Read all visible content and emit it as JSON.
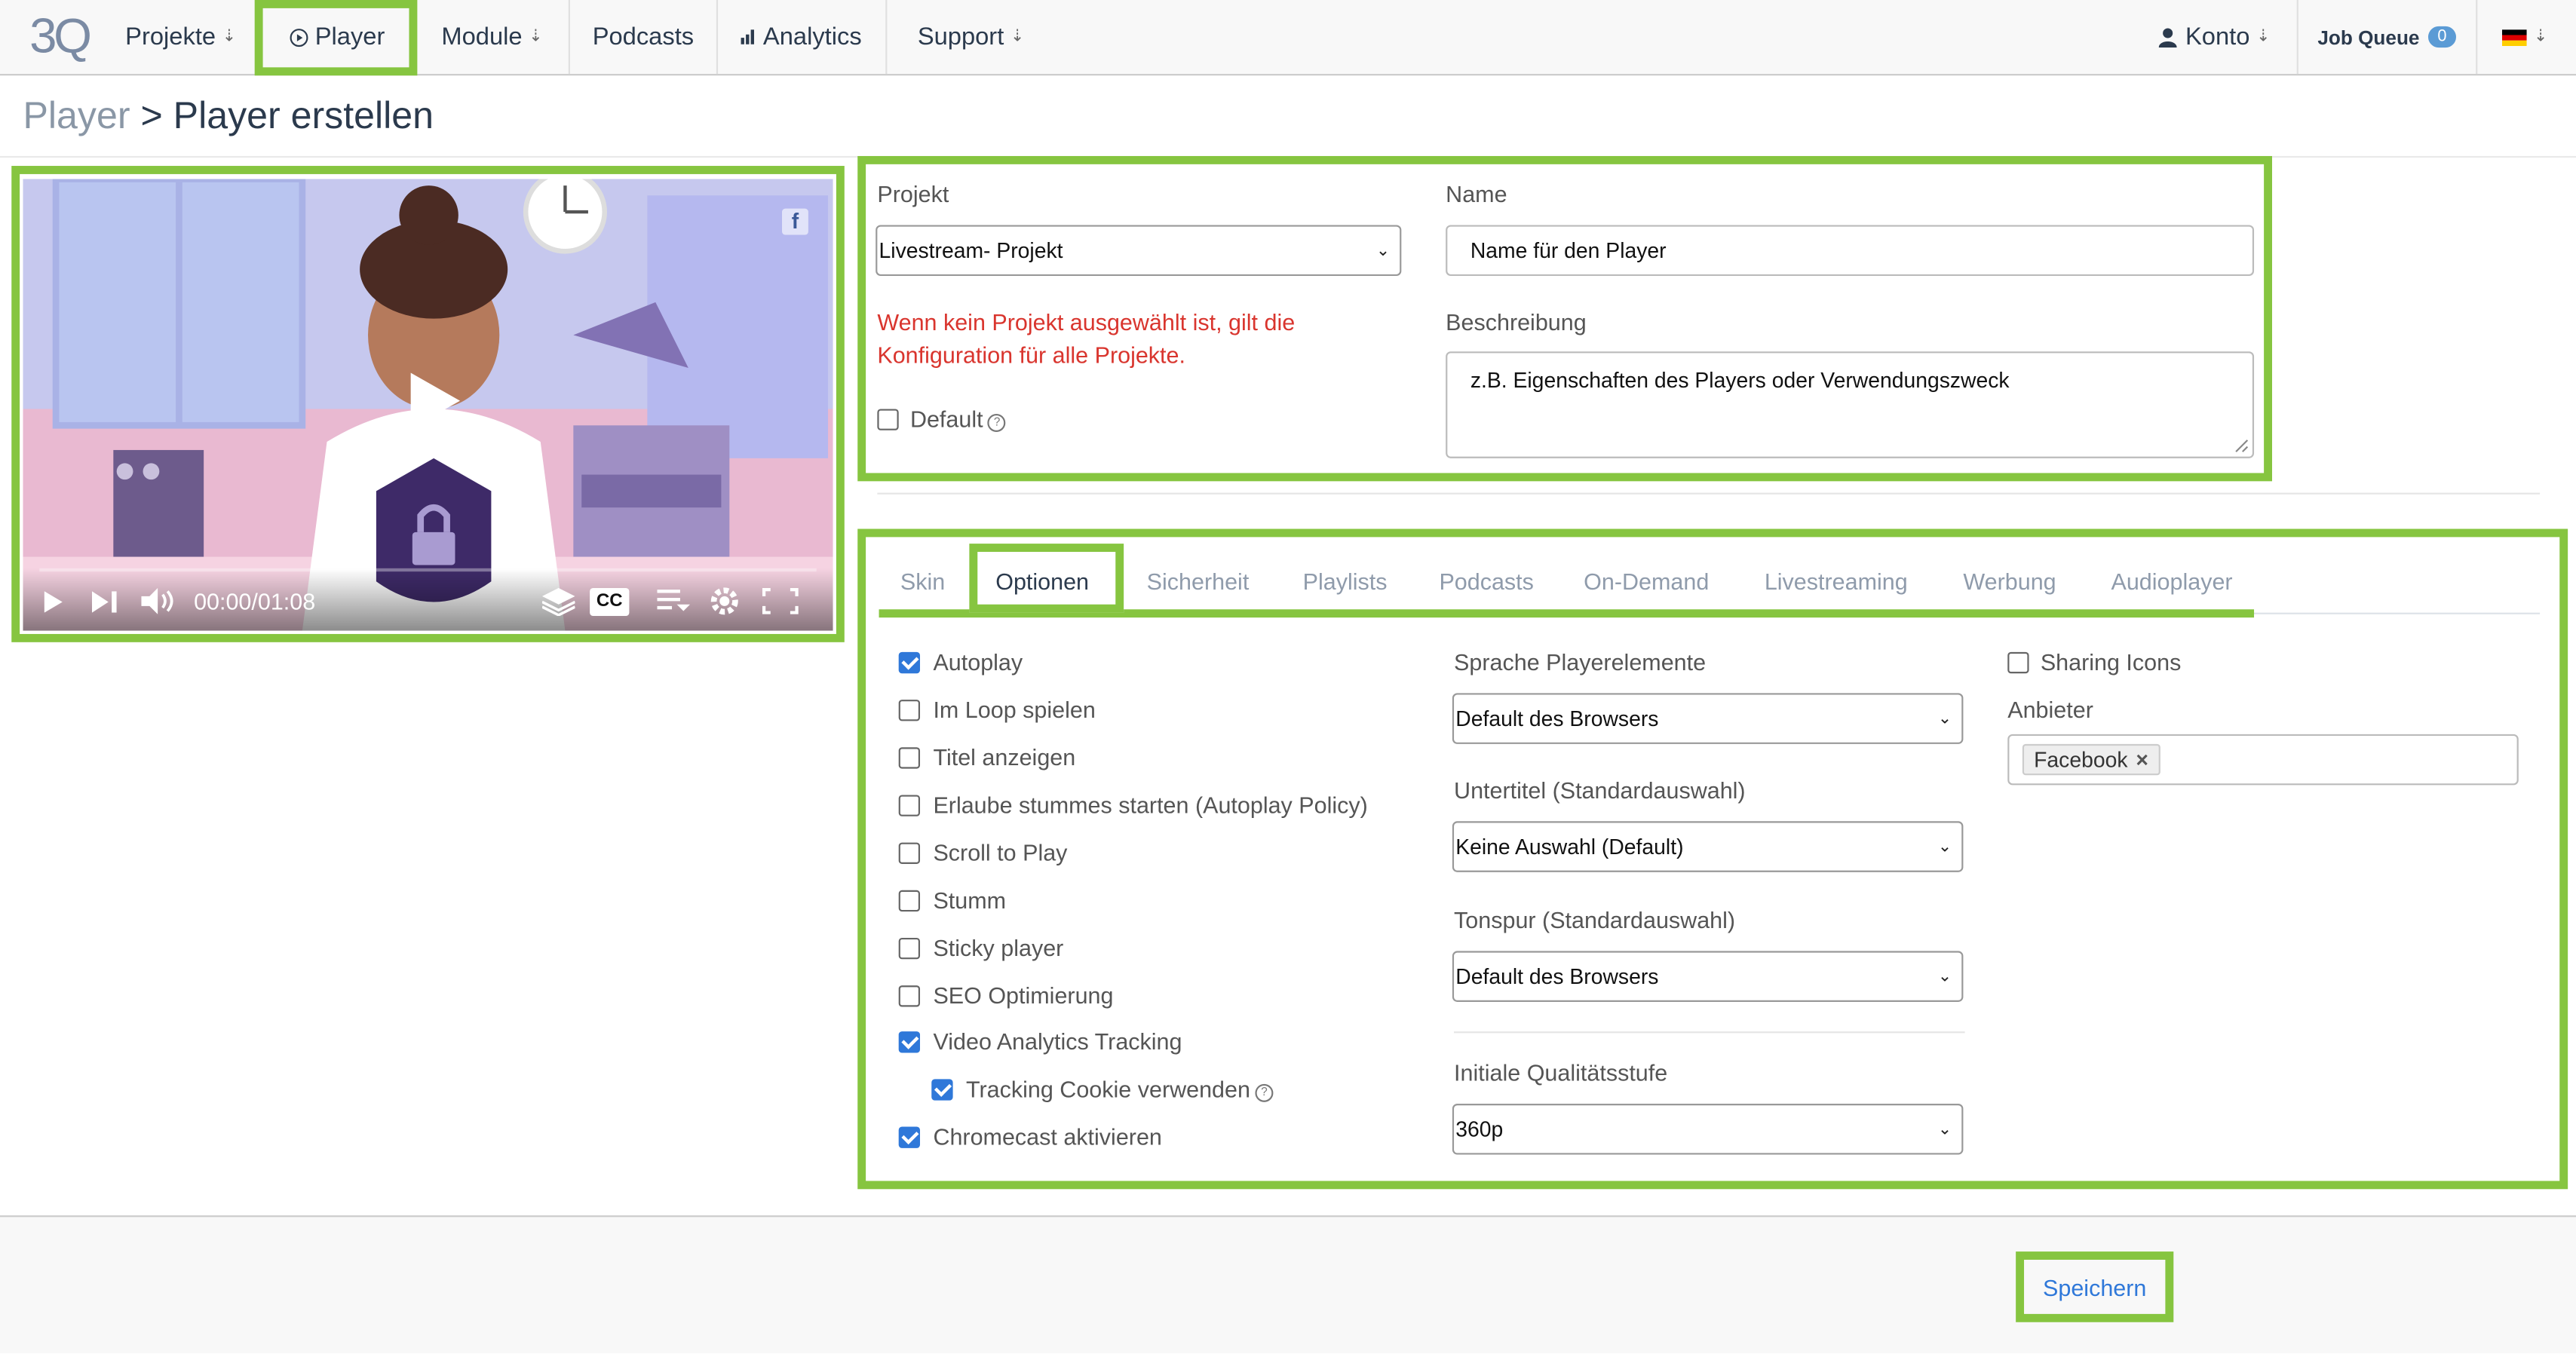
{
  "brand": {
    "logo_text": "3Q"
  },
  "nav": {
    "projekte": "Projekte",
    "player": "Player",
    "module": "Module",
    "podcasts": "Podcasts",
    "analytics": "Analytics",
    "support": "Support",
    "konto": "Konto",
    "job_queue": "Job Queue",
    "job_queue_count": "0",
    "dropdown_glyph": "⇣"
  },
  "breadcrumb": {
    "parent": "Player",
    "separator": " > ",
    "current": "Player erstellen"
  },
  "video": {
    "time": "00:00/01:08",
    "cc_label": "CC",
    "social_icon": "facebook-icon"
  },
  "form": {
    "projekt_label": "Projekt",
    "projekt_value": "Livestream- Projekt",
    "projekt_warning": "Wenn kein Projekt ausgewählt ist, gilt die Konfiguration für alle Projekte.",
    "default_label": "Default",
    "default_checked": false,
    "name_label": "Name",
    "name_value": "Name für den Player",
    "beschreibung_label": "Beschreibung",
    "beschreibung_value": "z.B. Eigenschaften des Players oder Verwendungszweck"
  },
  "tabs": [
    "Skin",
    "Optionen",
    "Sicherheit",
    "Playlists",
    "Podcasts",
    "On-Demand",
    "Livestreaming",
    "Werbung",
    "Audioplayer"
  ],
  "active_tab": "Optionen",
  "options": [
    {
      "label": "Autoplay",
      "checked": true
    },
    {
      "label": "Im Loop spielen",
      "checked": false
    },
    {
      "label": "Titel anzeigen",
      "checked": false
    },
    {
      "label": "Erlaube stummes starten (Autoplay Policy)",
      "checked": false
    },
    {
      "label": "Scroll to Play",
      "checked": false
    },
    {
      "label": "Stumm",
      "checked": false
    },
    {
      "label": "Sticky player",
      "checked": false
    },
    {
      "label": "SEO Optimierung",
      "checked": false
    },
    {
      "label": "Video Analytics Tracking",
      "checked": true
    },
    {
      "label": "Tracking Cookie verwenden",
      "checked": true
    },
    {
      "label": "Chromecast aktivieren",
      "checked": true
    }
  ],
  "selects": {
    "sprache_label": "Sprache Playerelemente",
    "sprache_value": "Default des Browsers",
    "untertitel_label": "Untertitel (Standardauswahl)",
    "untertitel_value": "Keine Auswahl (Default)",
    "tonspur_label": "Tonspur (Standardauswahl)",
    "tonspur_value": "Default des Browsers",
    "qualitaet_label": "Initiale Qualitätsstufe",
    "qualitaet_value": "360p"
  },
  "sharing": {
    "label": "Sharing Icons",
    "checked": false,
    "anbieter_label": "Anbieter",
    "tag": "Facebook",
    "tag_remove": "×"
  },
  "footer": {
    "save_label": "Speichern"
  },
  "colors": {
    "highlight": "#86c540",
    "link": "#2f78d9",
    "warning": "#d9352e",
    "checkbox_on": "#2f78d9"
  }
}
